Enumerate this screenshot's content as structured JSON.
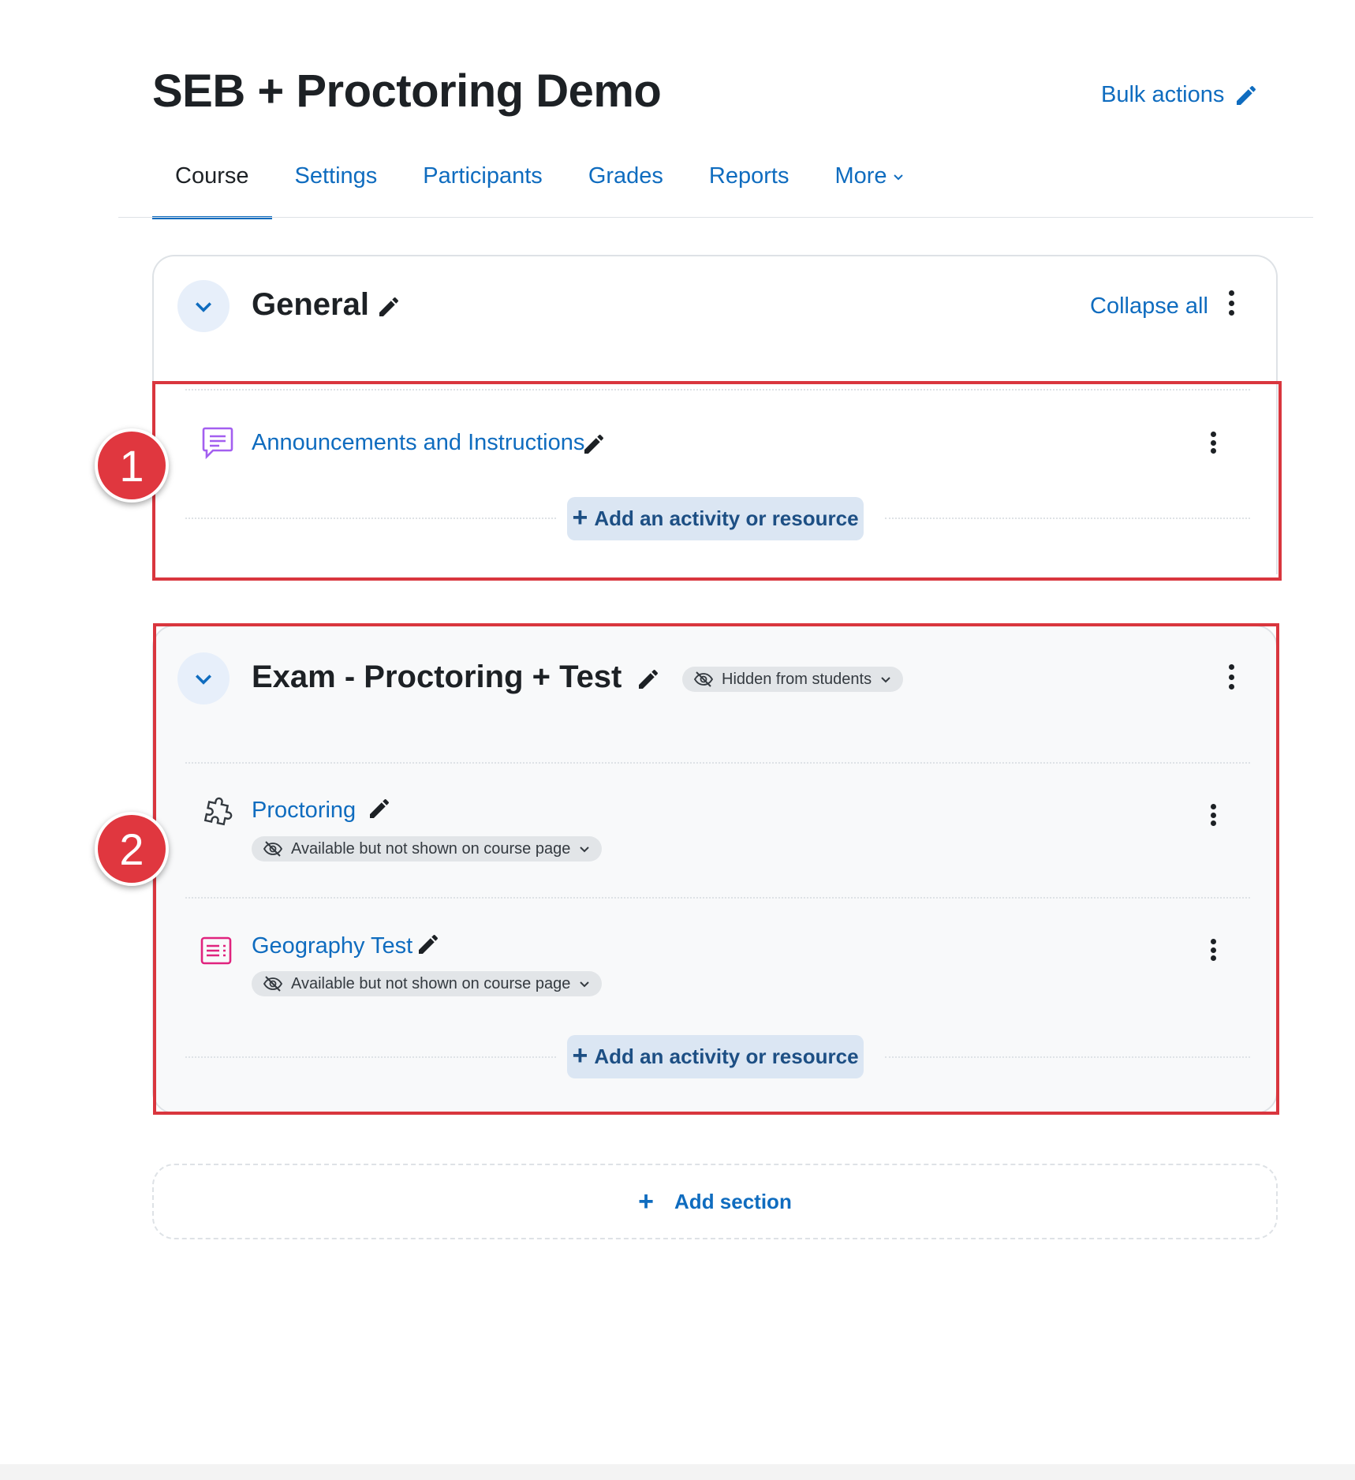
{
  "header": {
    "course_title": "SEB + Proctoring Demo",
    "bulk_actions_label": "Bulk actions"
  },
  "tabs": [
    {
      "label": "Course",
      "active": true
    },
    {
      "label": "Settings",
      "active": false
    },
    {
      "label": "Participants",
      "active": false
    },
    {
      "label": "Grades",
      "active": false
    },
    {
      "label": "Reports",
      "active": false
    },
    {
      "label": "More",
      "active": false
    }
  ],
  "sections": {
    "general": {
      "title": "General",
      "collapse_all_label": "Collapse all",
      "activities": [
        {
          "name": "Announcements and Instructions",
          "icon": "forum-icon"
        }
      ],
      "add_activity_label": "Add an activity or resource"
    },
    "exam": {
      "title": "Exam - Proctoring + Test",
      "visibility_badge": "Hidden from students",
      "activities": [
        {
          "name": "Proctoring",
          "icon": "plugin-puzzle-icon",
          "availability": "Available but not shown on course page"
        },
        {
          "name": "Geography Test",
          "icon": "quiz-icon",
          "availability": "Available but not shown on course page"
        }
      ],
      "add_activity_label": "Add an activity or resource"
    }
  },
  "add_section_label": "Add section",
  "markers": [
    "1",
    "2"
  ],
  "colors": {
    "accent": "#0f6cbf",
    "highlight": "#d9363e",
    "text": "#1d2125"
  }
}
